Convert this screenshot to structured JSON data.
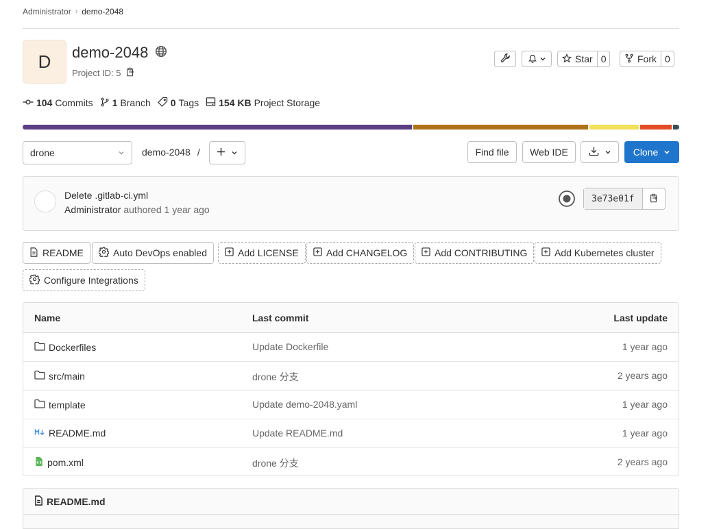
{
  "breadcrumb": {
    "parent": "Administrator",
    "current": "demo-2048"
  },
  "project": {
    "avatar_letter": "D",
    "name": "demo-2048",
    "id_label": "Project ID: 5",
    "star_label": "Star",
    "star_count": "0",
    "fork_label": "Fork",
    "fork_count": "0"
  },
  "stats": {
    "commits_count": "104",
    "commits_label": "Commits",
    "branch_count": "1",
    "branch_label": "Branch",
    "tags_count": "0",
    "tags_label": "Tags",
    "storage_size": "154 KB",
    "storage_label": "Project Storage"
  },
  "languages": [
    {
      "share": 59.8,
      "color": "#5c3e84"
    },
    {
      "share": 26.8,
      "color": "#b07219"
    },
    {
      "share": 7.6,
      "color": "#f1e05a"
    },
    {
      "share": 4.9,
      "color": "#e34c26"
    },
    {
      "share": 0.9,
      "color": "#384d54"
    }
  ],
  "toolbar": {
    "branch": "drone",
    "path": "demo-2048",
    "path_sep": "/",
    "find_file": "Find file",
    "web_ide": "Web IDE",
    "clone": "Clone"
  },
  "last_commit": {
    "title": "Delete .gitlab-ci.yml",
    "author": "Administrator",
    "meta": "authored 1 year ago",
    "sha": "3e73e01f"
  },
  "quick_links": [
    {
      "label": "README",
      "icon": "file-icon",
      "style": "solid"
    },
    {
      "label": "Auto DevOps enabled",
      "icon": "settings-icon",
      "style": "solid"
    },
    {
      "label": "Add LICENSE",
      "icon": "plus-square-icon",
      "style": "dashed"
    },
    {
      "label": "Add CHANGELOG",
      "icon": "plus-square-icon",
      "style": "dashed"
    },
    {
      "label": "Add CONTRIBUTING",
      "icon": "plus-square-icon",
      "style": "dashed"
    },
    {
      "label": "Add Kubernetes cluster",
      "icon": "plus-square-icon",
      "style": "dashed"
    },
    {
      "label": "Configure Integrations",
      "icon": "settings-icon",
      "style": "dashed"
    }
  ],
  "files": {
    "headers": {
      "name": "Name",
      "last_commit": "Last commit",
      "last_update": "Last update"
    },
    "rows": [
      {
        "name": "Dockerfiles",
        "icon": "folder-icon",
        "commit": "Update Dockerfile",
        "updated": "1 year ago"
      },
      {
        "name": "src/main",
        "icon": "folder-icon",
        "commit": "drone 分支",
        "updated": "2 years ago"
      },
      {
        "name": "template",
        "icon": "folder-icon",
        "commit": "Update demo-2048.yaml",
        "updated": "1 year ago"
      },
      {
        "name": "README.md",
        "icon": "markdown-icon",
        "commit": "Update README.md",
        "updated": "1 year ago"
      },
      {
        "name": "pom.xml",
        "icon": "xml-file-icon",
        "commit": "drone 分支",
        "updated": "2 years ago"
      }
    ]
  },
  "readme": {
    "title": "README.md"
  }
}
